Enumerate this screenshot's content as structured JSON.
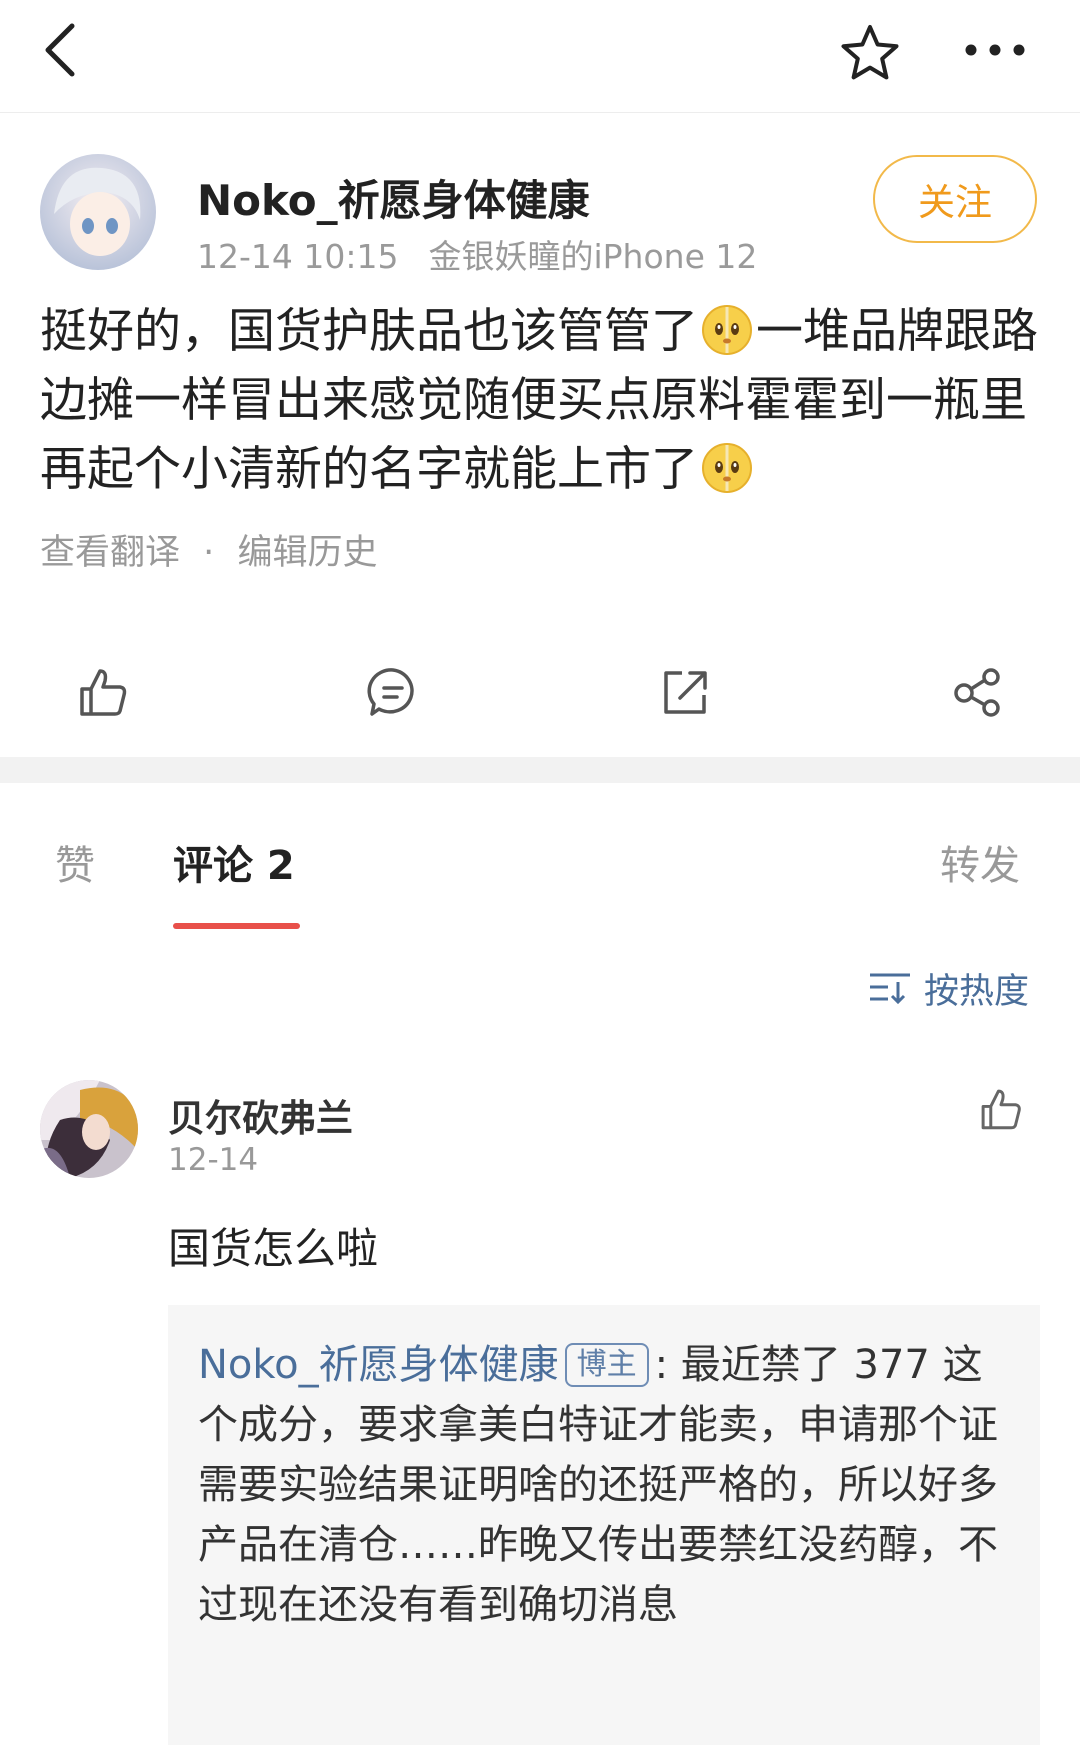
{
  "topbar": {
    "back_icon": "chevron-left-icon",
    "star_icon": "star-outline-icon",
    "more_icon": "more-dots-icon"
  },
  "post": {
    "author": "Noko_祈愿身体健康",
    "time": "12-14 10:15",
    "device": "金银妖瞳的iPhone 12",
    "follow_label": "关注",
    "text_parts": [
      "挺好的，国货护肤品也该管管了",
      "一堆品牌跟路边摊一样冒出来感觉随便买点原料霍霍到一瓶里再起个小清新的名字就能上市了"
    ],
    "emoji": "halo-face-emoji",
    "translate_link": "查看翻译",
    "separator": "·",
    "history_link": "编辑历史"
  },
  "actions": {
    "like_icon": "thumbs-up-icon",
    "comment_icon": "comment-icon",
    "repost_icon": "repost-icon",
    "share_icon": "share-icon"
  },
  "tabs": {
    "likes": "赞",
    "comments": "评论 2",
    "reposts": "转发"
  },
  "sort": {
    "label": "按热度",
    "icon": "sort-icon"
  },
  "comment": {
    "name": "贝尔砍弗兰",
    "date": "12-14",
    "text": "国货怎么啦",
    "reply": {
      "name": "Noko_祈愿身体健康",
      "badge": "博主",
      "text": ": 最近禁了 377 这个成分，要求拿美白特证才能卖，申请那个证需要实验结果证明啥的还挺严格的，所以好多产品在清仓……昨晚又传出要禁红没药醇，不过现在还没有看到确切消息"
    }
  },
  "colors": {
    "accent_orange": "#f09a1c",
    "link_blue": "#4a6e9a",
    "tab_underline": "#e8504a"
  }
}
